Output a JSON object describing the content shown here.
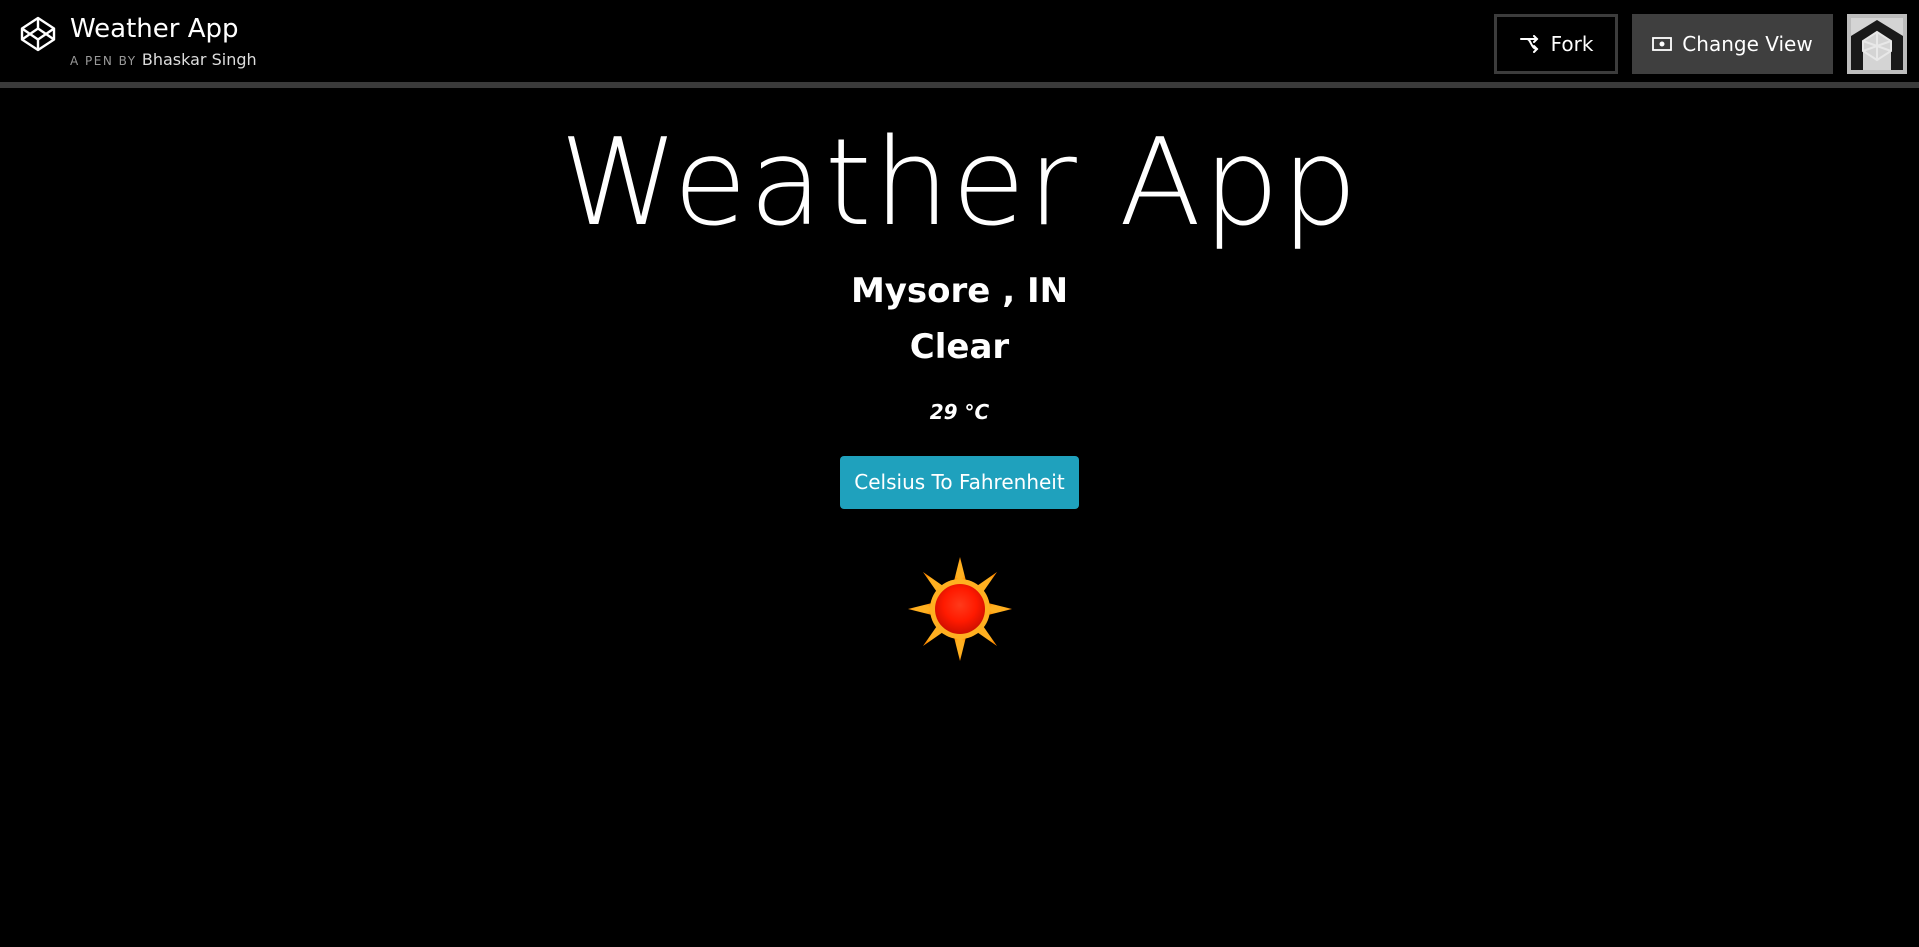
{
  "header": {
    "title": "Weather App",
    "author_prefix": "A PEN BY",
    "author_name": "Bhaskar Singh",
    "fork_label": "Fork",
    "change_view_label": "Change View"
  },
  "main": {
    "title": "Weather App",
    "location": "Mysore , IN",
    "condition": "Clear",
    "temperature": "29 °C",
    "convert_button_label": "Celsius To Fahrenheit",
    "weather_icon": "sun-icon"
  },
  "colors": {
    "background": "#000000",
    "button_accent": "#1fa1bd",
    "header_border": "#3a3a3a",
    "change_view_bg": "#3f3f3f"
  }
}
